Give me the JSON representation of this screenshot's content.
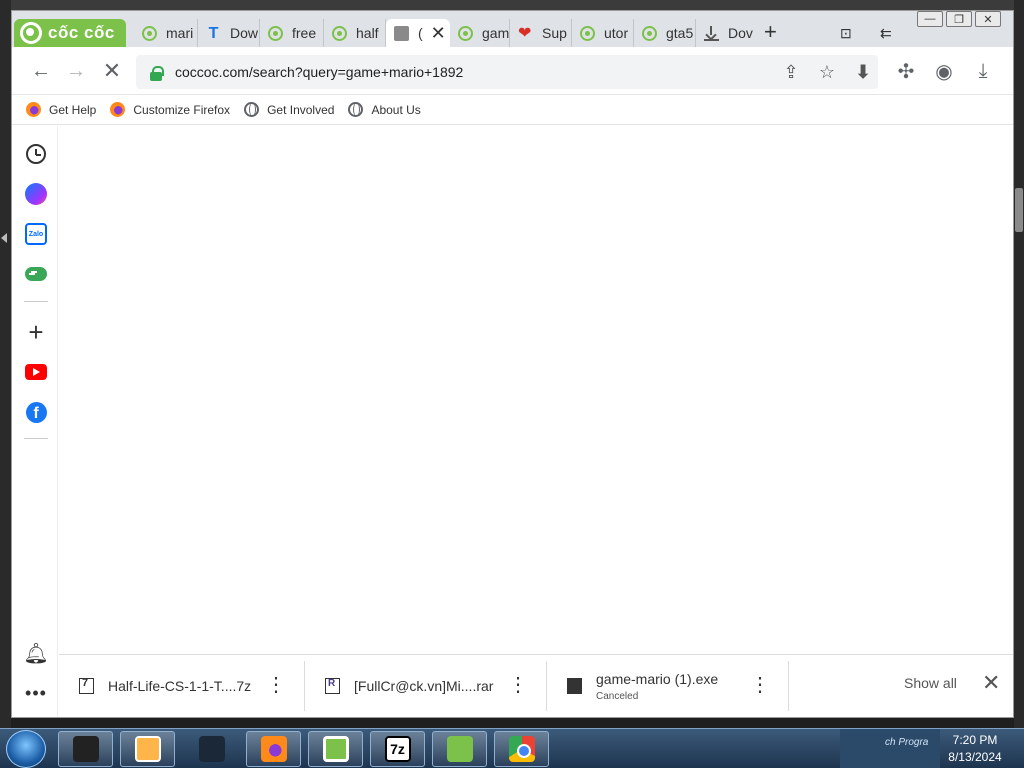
{
  "browser": {
    "logo_text": "cốc cốc",
    "tabs": [
      {
        "label": "mari",
        "icon": "coccoc-icon"
      },
      {
        "label": "Dow",
        "icon": "t-icon"
      },
      {
        "label": "free",
        "icon": "coccoc-icon"
      },
      {
        "label": "half",
        "icon": "coccoc-icon"
      },
      {
        "label": "(",
        "icon": "page-icon",
        "active": true
      },
      {
        "label": "gam",
        "icon": "coccoc-icon"
      },
      {
        "label": "Sup",
        "icon": "heart-icon"
      },
      {
        "label": "utor",
        "icon": "coccoc-icon"
      },
      {
        "label": "gta5",
        "icon": "coccoc-icon"
      },
      {
        "label": "Dov",
        "icon": "download-icon"
      }
    ]
  },
  "toolbar": {
    "url": "coccoc.com/search?query=game+mario+1892"
  },
  "bookmarks": [
    {
      "label": "Get Help",
      "icon": "firefox-icon"
    },
    {
      "label": "Customize Firefox",
      "icon": "firefox-icon"
    },
    {
      "label": "Get Involved",
      "icon": "globe-icon"
    },
    {
      "label": "About Us",
      "icon": "globe-icon"
    }
  ],
  "sidebar": {
    "zalo_label": "Zalo",
    "fb_letter": "f"
  },
  "downloads": {
    "items": [
      {
        "name": "Half-Life-CS-1-1-T....7z",
        "status": ""
      },
      {
        "name": "[FullCr@ck.vn]Mi....rar",
        "status": ""
      },
      {
        "name": "game-mario (1).exe",
        "status": "Canceled"
      }
    ],
    "show_all": "Show all"
  },
  "taskbar": {
    "tray_text": "ch Progra",
    "time": "7:20 PM",
    "date": "8/13/2024",
    "app_7z": "7z"
  },
  "colors": {
    "accent": "#7cc149",
    "link": "#1a73e8"
  }
}
